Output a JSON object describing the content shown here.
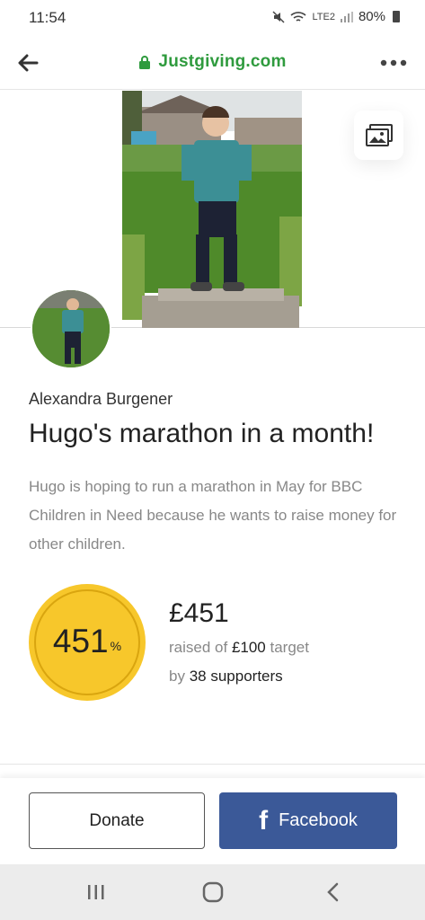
{
  "status_bar": {
    "time": "11:54",
    "network_label": "LTE2",
    "battery": "80%"
  },
  "browser": {
    "url": "Justgiving.com",
    "icons": [
      "back-arrow-icon",
      "lock-icon",
      "more-dots-icon"
    ],
    "accent_color": "#2f9b3e"
  },
  "page": {
    "organiser": "Alexandra Burgener",
    "title": "Hugo's marathon in a month!",
    "description": "Hugo is hoping to run a marathon in May for BBC Children in Need because he wants to raise money for other children.",
    "progress": {
      "percent_value": "451",
      "percent_sign": "%",
      "raised": "£451",
      "raised_of_prefix": "raised of",
      "target": "£100",
      "target_suffix": "target",
      "by_prefix": "by",
      "supporters": "38 supporters",
      "circle_color": "#f7c72b"
    }
  },
  "actions": {
    "donate_label": "Donate",
    "facebook_label": "Facebook",
    "facebook_color": "#3b5998"
  },
  "system_nav": {
    "icons": [
      "recent-apps-icon",
      "home-icon",
      "back-chevron-icon"
    ]
  }
}
